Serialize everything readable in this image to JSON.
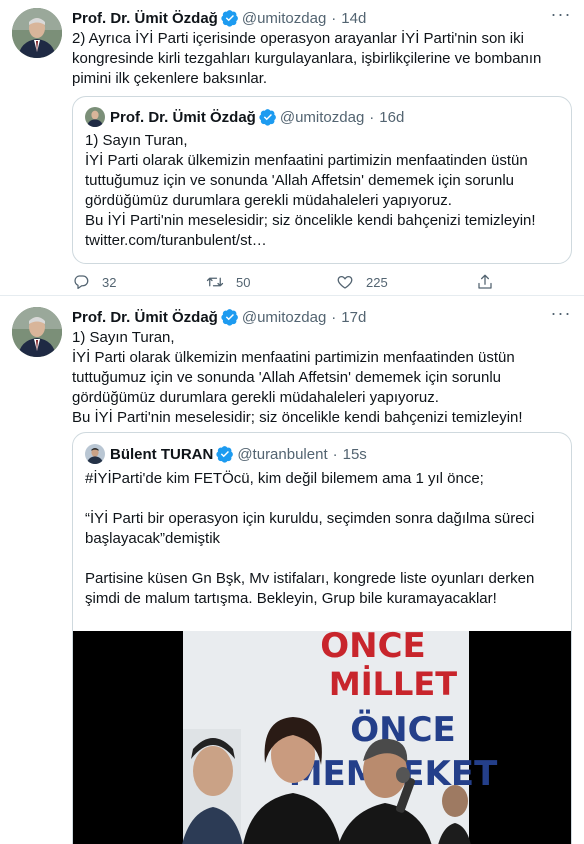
{
  "tweets": [
    {
      "author_name": "Prof. Dr. Ümit Özdağ",
      "handle": "@umitozdag",
      "time": "14d",
      "text": "2) Ayrıca İYİ Parti içerisinde operasyon arayanlar İYİ Parti'nin son iki kongresinde kirli tezgahları kurgulayanlara, işbirlikçilerine ve bombanın pimini ilk çekenlere baksınlar.",
      "quote": {
        "author_name": "Prof. Dr. Ümit Özdağ",
        "handle": "@umitozdag",
        "time": "16d",
        "text": "1) Sayın Turan,\nİYİ Parti olarak ülkemizin menfaatini partimizin menfaatinden üstün tuttuğumuz için ve sonunda 'Allah Affetsin' dememek için sorunlu gördüğümüz durumlara gerekli müdahaleleri yapıyoruz.\nBu İYİ Parti'nin meselesidir; siz öncelikle kendi bahçenizi temizleyin!\ntwitter.com/turanbulent/st…"
      },
      "reply_count": "32",
      "retweet_count": "50",
      "like_count": "225"
    },
    {
      "author_name": "Prof. Dr. Ümit Özdağ",
      "handle": "@umitozdag",
      "time": "17d",
      "text": "1) Sayın Turan,\nİYİ Parti olarak ülkemizin menfaatini partimizin menfaatinden üstün tuttuğumuz için ve sonunda 'Allah Affetsin' dememek için sorunlu gördüğümüz durumlara gerekli müdahaleleri yapıyoruz.\nBu İYİ Parti'nin meselesidir; siz öncelikle kendi bahçenizi temizleyin!",
      "quote": {
        "author_name": "Bülent TURAN",
        "handle": "@turanbulent",
        "time": "15s",
        "text": "#İYİParti'de kim FETÖcü, kim değil bilemem ama 1 yıl önce;\n\n“İYİ Parti bir operasyon için kuruldu, seçimden sonra dağılma süreci başlayacak”demiştik\n\nPartisine küsen Gn Bşk, Mv istifaları, kongrede liste oyunları derken şimdi de malum tartışma. Bekleyin, Grup bile kuramayacaklar!",
        "media_sign": [
          "ÖNCE",
          "MİLLET",
          "ÖNCE",
          "MEMLEKET"
        ]
      }
    }
  ],
  "colors": {
    "verified": "#1d9bf0",
    "secondary_text": "#536471",
    "sign_red": "#c8252c"
  },
  "icons": [
    "more-icon",
    "verified-icon",
    "reply-icon",
    "retweet-icon",
    "like-icon",
    "share-icon"
  ]
}
